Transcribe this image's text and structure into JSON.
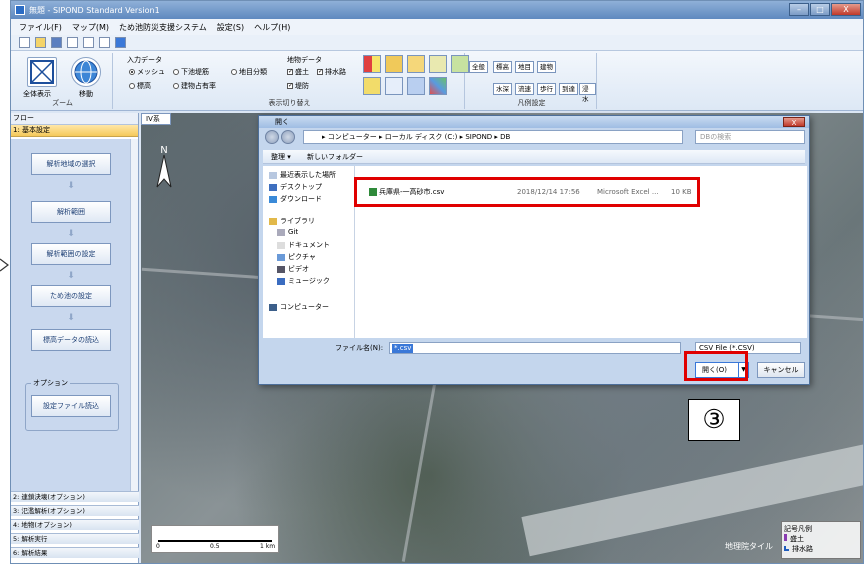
{
  "window": {
    "title": "無題 - SIPOND Standard  Version1",
    "controls": [
      "–",
      "□",
      "X"
    ]
  },
  "menu": [
    "ファイル(F)",
    "マップ(M)",
    "ため池防災支援システム",
    "設定(S)",
    "ヘルプ(H)"
  ],
  "ribbon": {
    "zoom": {
      "full_label": "全体表示",
      "move_label": "移動",
      "group_label": "ズーム"
    },
    "input_data": {
      "title": "入力データ",
      "options": [
        "メッシュ",
        "下池堤筋",
        "地目分類",
        "標高",
        "建物占有率"
      ]
    },
    "feature_data": {
      "title": "地物データ",
      "checks": [
        "盛土",
        "排水路",
        "堤防"
      ]
    },
    "display_group_label": "表示切り替え",
    "legend": {
      "buttons": [
        "全般",
        "標高",
        "地目",
        "建物",
        "水深",
        "流速",
        "歩行",
        "到達",
        "浸水"
      ],
      "group_label": "凡例設定"
    }
  },
  "left_panel": {
    "header": "フロー",
    "section": "1: 基本設定",
    "steps": [
      "解析地域の選択",
      "解析範囲",
      "解析範囲の設定",
      "ため池の設定",
      "標高データの読込"
    ],
    "option_label": "オプション",
    "option_button": "設定ファイル読込",
    "bottom_sections": [
      "2: 連鎖決壊(オプション)",
      "3: 氾濫解析(オプション)",
      "4: 地物(オプション)",
      "5: 解析実行",
      "6: 解析結果"
    ]
  },
  "map": {
    "tab": "IV系",
    "north_label": "N",
    "scale": {
      "ticks": [
        "0",
        "0.5",
        "1 km"
      ]
    },
    "legend_title": "記号凡例",
    "legend_items": [
      "盛土",
      "排水路"
    ],
    "copyright": "地理院タイル"
  },
  "dialog": {
    "title": "開く",
    "close": "X",
    "address": "▸ コンピューター ▸ ローカル ディスク (C:) ▸ SIPOND ▸ DB",
    "search_placeholder": "DBの検索",
    "organize": "整理 ▾",
    "new_folder": "新しいフォルダー",
    "nav": [
      "最近表示した場所",
      "デスクトップ",
      "ダウンロード",
      "ライブラリ",
      "Git",
      "ドキュメント",
      "ピクチャ",
      "ビデオ",
      "ミュージック",
      "コンピューター"
    ],
    "file": {
      "name": "兵庫県-一高砂市.csv",
      "date": "2018/12/14 17:56",
      "type": "Microsoft Excel ...",
      "size": "10 KB"
    },
    "filename_label": "ファイル名(N):",
    "filename_value": "*.csv",
    "filter": "CSV File (*.CSV)",
    "open": "開く(O)",
    "cancel": "キャンセル"
  },
  "annotation": {
    "step": "③"
  }
}
